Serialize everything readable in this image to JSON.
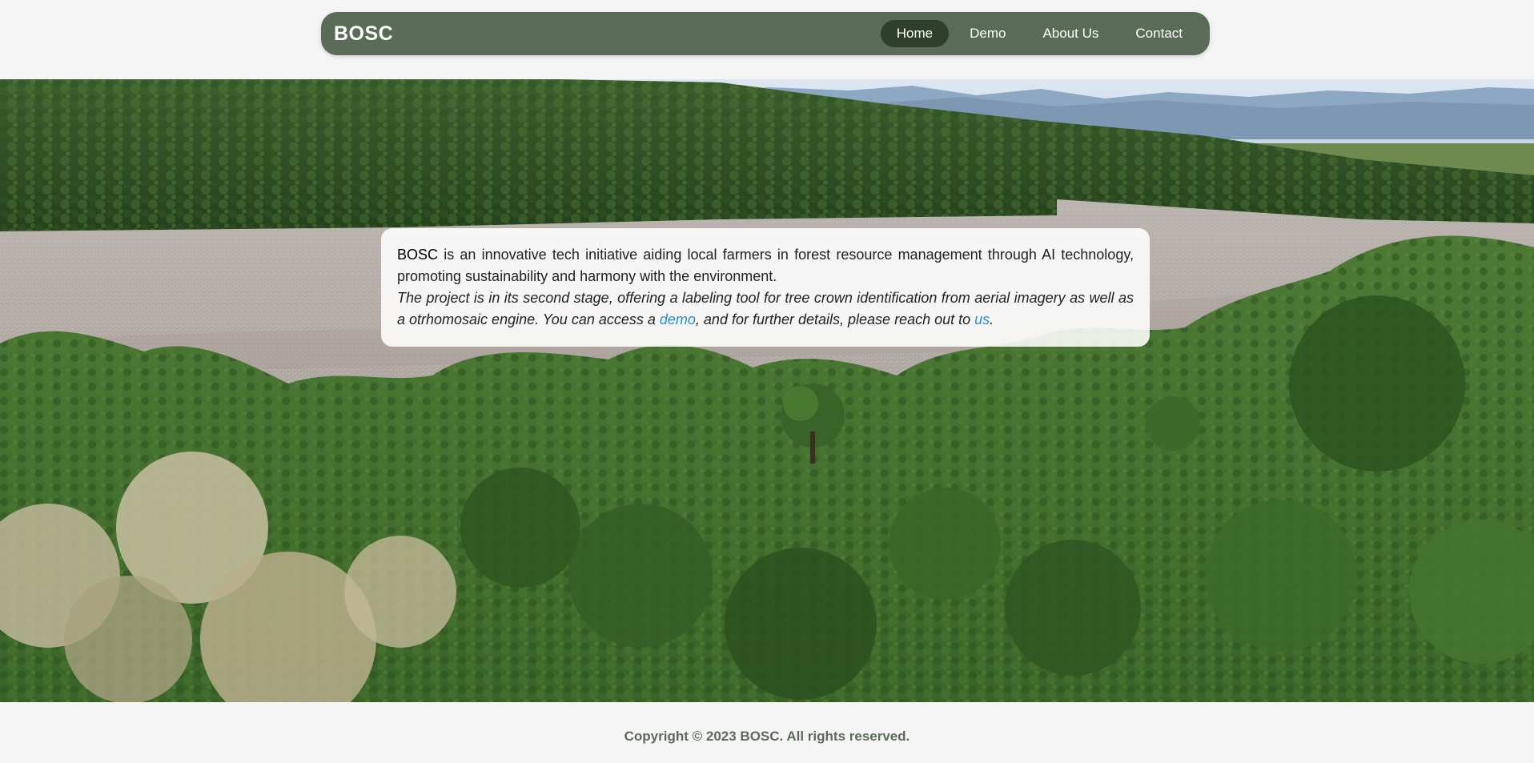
{
  "brand": "BOSC",
  "nav": {
    "items": [
      {
        "label": "Home",
        "active": true
      },
      {
        "label": "Demo",
        "active": false
      },
      {
        "label": "About Us",
        "active": false
      },
      {
        "label": "Contact",
        "active": false
      }
    ]
  },
  "hero": {
    "image": "aerial-forest-field-photo",
    "intro": {
      "brand_word": "BOSC",
      "text": " is an innovative tech initiative aiding local farmers in forest resource management through AI technology, promoting sustainability and harmony with the environment."
    },
    "stage": {
      "text_before": "The project is in its second stage, offering a labeling tool for tree crown identification from aerial imagery as well as a otrhomosaic engine. You can access a ",
      "demo_link": "demo",
      "text_middle": ", and for further details, please reach out to ",
      "us_link": "us",
      "text_after": "."
    }
  },
  "footer": {
    "copyright": "Copyright © 2023 BOSC. All rights reserved."
  },
  "colors": {
    "navbar": "#5a6b58",
    "nav_active": "#2f3f2c",
    "link": "#2a8bd6",
    "footer_text": "#5a6b58",
    "page_bg": "#f5f5f5"
  }
}
